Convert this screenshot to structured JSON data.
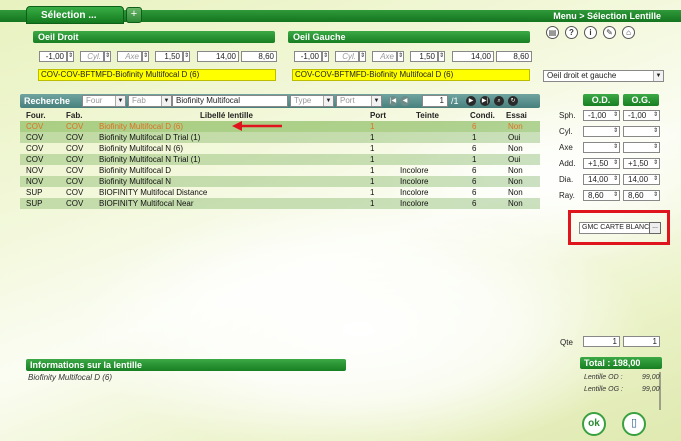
{
  "window": {
    "title": "Sélection ...",
    "new_tab_label": "+",
    "breadcrumb": "Menu > Sélection Lentille"
  },
  "top_icons": [
    "printer-icon",
    "help-icon",
    "info-icon",
    "settings-icon",
    "close-icon"
  ],
  "right_eye": {
    "header": "Oeil Droit",
    "sph": "-1,00",
    "cyl_placeholder": "Cyl.",
    "axe_placeholder": "Axe",
    "add": "1,50",
    "dia": "14,00",
    "ray": "8,60",
    "lens_ref": "COV-COV-BFTMFD-Biofinity Multifocal D (6)"
  },
  "left_eye": {
    "header": "Oeil Gauche",
    "sph": "-1,00",
    "cyl_placeholder": "Cyl.",
    "axe_placeholder": "Axe",
    "add": "1,50",
    "dia": "14,00",
    "ray": "8,60",
    "lens_ref": "COV-COV-BFTMFD-Biofinity Multifocal D (6)"
  },
  "eye_select": "Oeil droit et gauche",
  "search": {
    "label": "Recherche",
    "four_placeholder": "Four",
    "fab_placeholder": "Fab",
    "query": "Biofinity Multifocal",
    "type_placeholder": "Type",
    "port_placeholder": "Port",
    "page": "1",
    "page_sep": "/1"
  },
  "table": {
    "headers": {
      "four": "Four.",
      "fab": "Fab.",
      "libelle": "Libellé lentille",
      "port": "Port",
      "teinte": "Teinte",
      "condi": "Condi.",
      "essai": "Essai"
    },
    "rows": [
      {
        "four": "COV",
        "fab": "COV",
        "libelle": "Biofinity Multifocal D (6)",
        "port": "1",
        "teinte": "",
        "condi": "6",
        "essai": "Non"
      },
      {
        "four": "COV",
        "fab": "COV",
        "libelle": "Biofinity Multifocal D Trial (1)",
        "port": "1",
        "teinte": "",
        "condi": "1",
        "essai": "Oui"
      },
      {
        "four": "COV",
        "fab": "COV",
        "libelle": "Biofinity Multifocal N (6)",
        "port": "1",
        "teinte": "",
        "condi": "6",
        "essai": "Non"
      },
      {
        "four": "COV",
        "fab": "COV",
        "libelle": "Biofinity Multifocal N Trial (1)",
        "port": "1",
        "teinte": "",
        "condi": "1",
        "essai": "Oui"
      },
      {
        "four": "NOV",
        "fab": "COV",
        "libelle": "Biofinity Multifocal D",
        "port": "1",
        "teinte": "Incolore",
        "condi": "6",
        "essai": "Non"
      },
      {
        "four": "NOV",
        "fab": "COV",
        "libelle": "Biofinity Multifocal N",
        "port": "1",
        "teinte": "Incolore",
        "condi": "6",
        "essai": "Non"
      },
      {
        "four": "SUP",
        "fab": "COV",
        "libelle": "BIOFINITY Multifocal Distance",
        "port": "1",
        "teinte": "Incolore",
        "condi": "6",
        "essai": "Non"
      },
      {
        "four": "SUP",
        "fab": "COV",
        "libelle": "BIOFINITY Multifocal Near",
        "port": "1",
        "teinte": "Incolore",
        "condi": "6",
        "essai": "Non"
      }
    ]
  },
  "params": {
    "od_header": "O.D.",
    "og_header": "O.G.",
    "labels": {
      "sph": "Sph.",
      "cyl": "Cyl.",
      "axe": "Axe",
      "add": "Add.",
      "dia": "Dia.",
      "ray": "Ray."
    },
    "od": {
      "sph": "-1,00",
      "cyl": "",
      "axe": "",
      "add": "+1,50",
      "dia": "14,00",
      "ray": "8,60"
    },
    "og": {
      "sph": "-1,00",
      "cyl": "",
      "axe": "",
      "add": "+1,50",
      "dia": "14,00",
      "ray": "8,60"
    }
  },
  "gmc": {
    "value": "GMC CARTE BLANCHE",
    "button": "..."
  },
  "qty": {
    "label": "Qte",
    "od": "1",
    "og": "1"
  },
  "info": {
    "header": "Informations sur la lentille",
    "text": "Biofinity Multifocal D (6)"
  },
  "total": {
    "label": "Total : 198,00",
    "od_label": "Lentille OD :",
    "od_value": "99,00",
    "og_label": "Lentille OG :",
    "og_value": "99,00"
  },
  "buttons": {
    "ok": "ok"
  },
  "colors": {
    "accent_green": "#177f22",
    "highlight_yellow": "#ffff00",
    "annotation_red": "#e0141c",
    "selected_text": "#e07020"
  }
}
